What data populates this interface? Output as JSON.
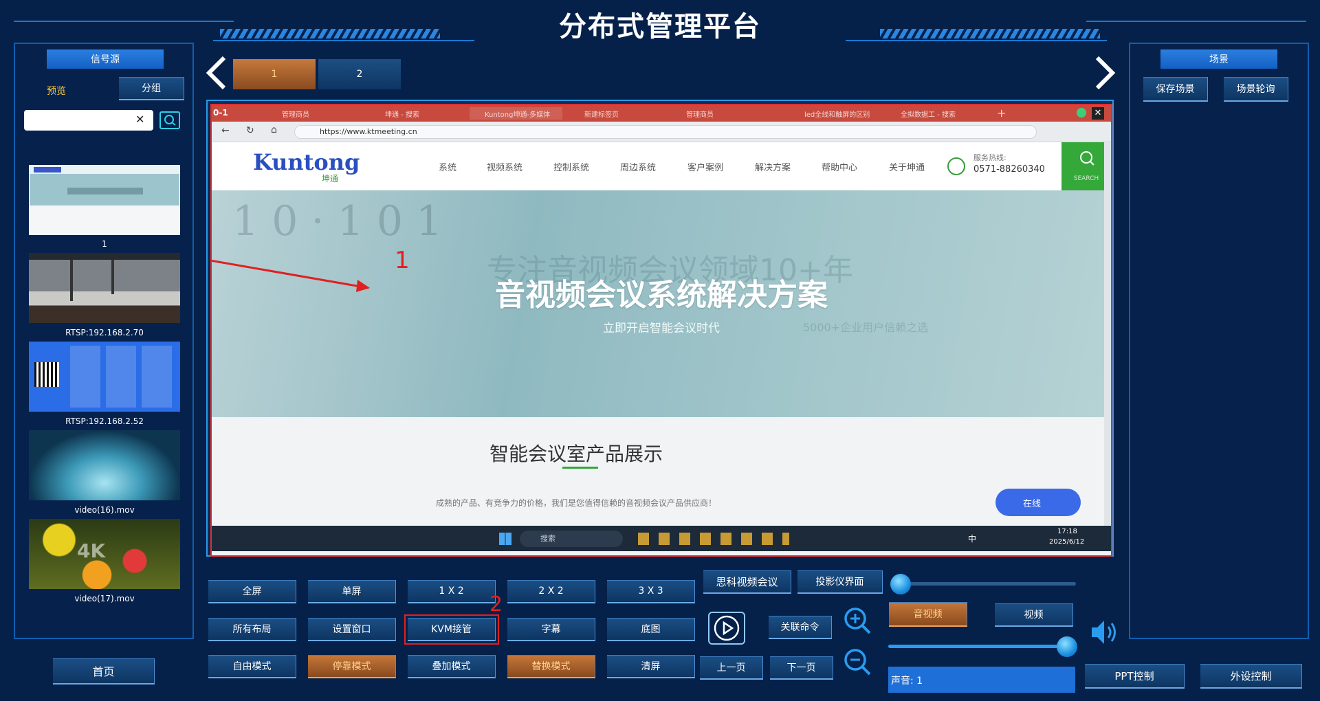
{
  "app": {
    "title": "分布式管理平台"
  },
  "left_panel": {
    "header": "信号源",
    "preview_label": "预览",
    "group_button": "分组",
    "search": {
      "value": "",
      "placeholder": ""
    },
    "sources": [
      {
        "label": "1"
      },
      {
        "label": "RTSP:192.168.2.70"
      },
      {
        "label": "RTSP:192.168.2.52"
      },
      {
        "label": "video(16).mov"
      },
      {
        "label": "video(17).mov"
      }
    ]
  },
  "pages": {
    "tabs": [
      "1",
      "2"
    ],
    "active": "1"
  },
  "preview": {
    "window_id": "0-1",
    "browser_tabs": [
      "管理商员",
      "坤通 - 搜索",
      "Kuntong坤通-多媒体",
      "新建标签页",
      "管理商员",
      "led全线和触屏的区别",
      "全拟数据工 - 搜索"
    ],
    "url": "https://www.ktmeeting.cn",
    "site": {
      "logo": "Kuntong",
      "logo_sub": "坤通",
      "nav": [
        "系统",
        "视频系统",
        "控制系统",
        "周边系统",
        "客户案例",
        "解决方案",
        "帮助中心",
        "关于坤通"
      ],
      "hotline_label": "服务热线:",
      "hotline": "0571-88260340",
      "search_label": "SEARCH",
      "hero_title": "音视频会议系统解决方案",
      "hero_sub": "立即开启智能会议时代",
      "hero_bg_text": "专注音视频会议领域10+年",
      "hero_bg_sub": "5000+企业用户信赖之选",
      "section_title": "智能会议室产品展示",
      "section_sub": "成熟的产品、有竞争力的价格，我们是您值得信赖的音视频会议产品供应商！",
      "chat_label": "在线"
    },
    "taskbar": {
      "search": "搜索",
      "time": "17:18",
      "date": "2025/6/12",
      "ime": "中"
    },
    "annotations": [
      "1",
      "2"
    ]
  },
  "layout_buttons": {
    "row1": [
      "全屏",
      "单屏",
      "1 X 2",
      "2 X 2",
      "3 X 3"
    ],
    "row2": [
      "所有布局",
      "设置窗口",
      "KVM接管",
      "字幕",
      "底图"
    ],
    "row3": [
      "自由模式",
      "停靠模式",
      "叠加模式",
      "替换模式",
      "清屏"
    ],
    "orange_row3": [
      1,
      3
    ]
  },
  "middle_controls": {
    "cisco": "思科视频会议",
    "projector": "投影仪界面",
    "relate": "关联命令",
    "prev": "上一页",
    "next": "下一页"
  },
  "right_controls": {
    "av": "音视频",
    "video": "视频",
    "volume_text": "声音: 1",
    "ppt": "PPT控制",
    "peripheral": "外设控制",
    "top_slider_level": 0.0,
    "volume_slider_level": 1.0
  },
  "scene_panel": {
    "header": "场景",
    "save": "保存场景",
    "tour": "场景轮询"
  },
  "home_button": "首页",
  "colors": {
    "accent": "#1a78d0",
    "orange": "#c6783a",
    "annotation_red": "#e02020"
  }
}
